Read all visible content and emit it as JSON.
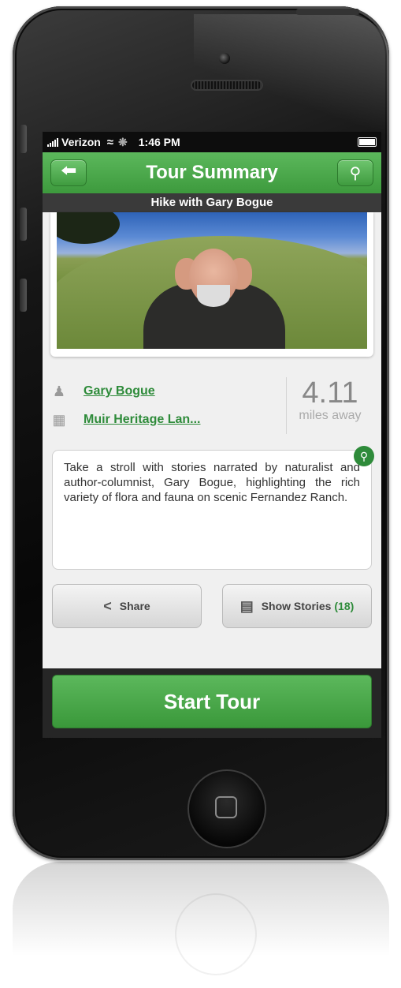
{
  "status_bar": {
    "carrier": "Verizon",
    "time": "1:46 PM"
  },
  "nav": {
    "title": "Tour Summary",
    "back_icon": "arrow-left-icon",
    "map_icon": "map-pin-icon"
  },
  "subtitle": "Hike with Gary Bogue",
  "tour": {
    "narrator": "Gary Bogue",
    "organization": "Muir Heritage Lan...",
    "distance_value": "4.11",
    "distance_unit": "miles away",
    "description": "Take a stroll with stories narrated by naturalist and author-columnist, Gary Bogue, highlighting the rich variety of flora and fauna on scenic Fernandez Ranch."
  },
  "actions": {
    "share_label": "Share",
    "stories_label": "Show Stories",
    "stories_count": "(18)"
  },
  "start_label": "Start Tour",
  "colors": {
    "accent": "#3d9a3d",
    "link": "#2e8b3a"
  }
}
